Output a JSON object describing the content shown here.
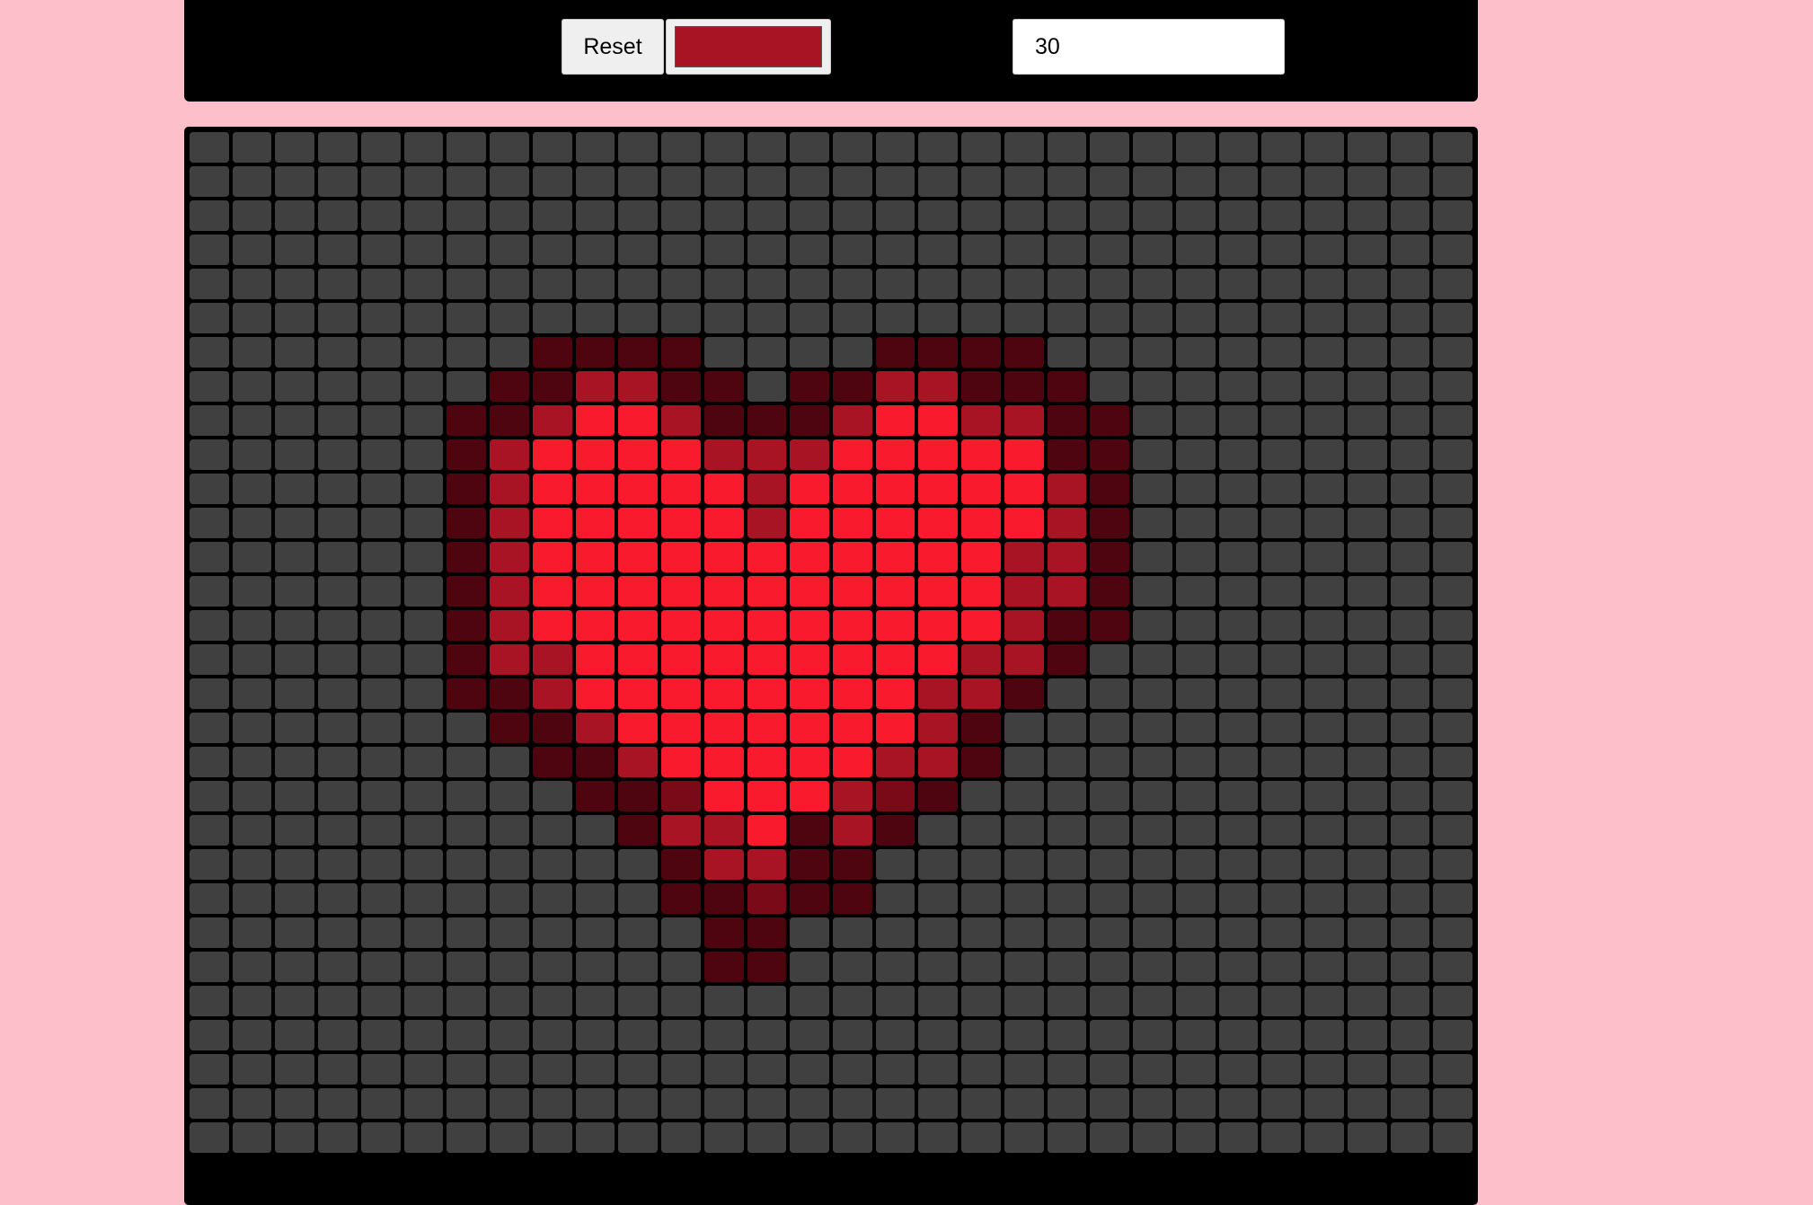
{
  "toolbar": {
    "reset_label": "Reset",
    "color_value": "#a81423",
    "grid_size_value": "30"
  },
  "grid": {
    "columns": 30,
    "rows_visible": 30,
    "empty_color": "#404040",
    "palette": {
      "0": "#404040",
      "1": "#4e0510",
      "2": "#7a0a17",
      "3": "#a81423",
      "4": "#f91a2e"
    },
    "shade_rows": [
      "000000000000000000000000000000",
      "000000000000000000000000000000",
      "000000000000000000000000000000",
      "000000000000000000000000000000",
      "000000000000000000000000000000",
      "000000000000000000000000000000",
      "000000001111000011110000000000",
      "000000011331101133111000000000",
      "000000113443111344331100000000",
      "000000134444333444441100000000",
      "000000134444434444443100000000",
      "000000134444434444443100000000",
      "000000134444444444433100000000",
      "000000134444444444433100000000",
      "000000134444444444431100000000",
      "000000133444444444331000000000",
      "000000113444444443310000000000",
      "000000011344444443100000000000",
      "000000001134444433100000000000",
      "000000000112444321000000000000",
      "000000000013341310000000000000",
      "000000000001331100000000000000",
      "000000000001121100000000000000",
      "000000000000110000000000000000",
      "000000000000110000000000000000",
      "000000000000000000000000000000",
      "000000000000000000000000000000",
      "000000000000000000000000000000",
      "000000000000000000000000000000",
      "000000000000000000000000000000"
    ]
  }
}
